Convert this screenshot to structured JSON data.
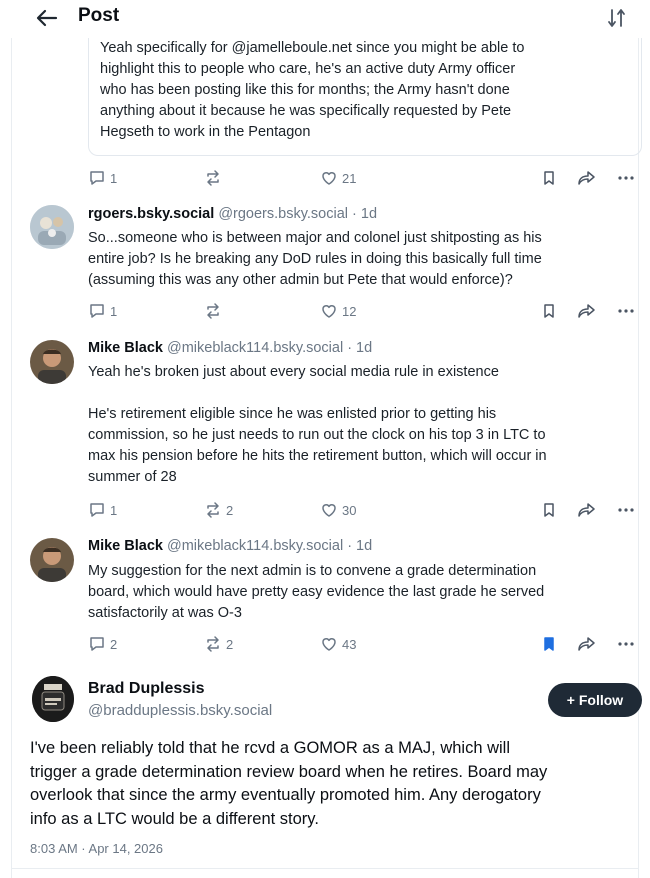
{
  "header": {
    "title": "Post",
    "back_icon": "arrow-left-icon",
    "filter_icon": "sort-filter-icon"
  },
  "quoted": {
    "lines": [
      "Yeah specifically for @jamelleboule.net since you might be able to",
      "highlight this to people who care, he's an active duty Army officer",
      "who has been posting like this for months; the Army hasn't done",
      "anything about it because he was specifically requested by Pete",
      "Hegseth to work in the Pentagon"
    ],
    "actions": {
      "replies": "1",
      "reposts": "",
      "likes": "21"
    }
  },
  "replies": [
    {
      "name": "rgoers.bsky.social",
      "handle": "@rgoers.bsky.social · 1d",
      "lines": [
        "So...someone who is between major and colonel just shitposting as his",
        "entire job? Is he breaking any DoD rules in doing this basically full time",
        "(assuming this was any other admin but Pete that would enforce)?"
      ],
      "actions": {
        "replies": "1",
        "reposts": "",
        "likes": "12"
      }
    },
    {
      "name": "Mike Black",
      "handle": "@mikeblack114.bsky.social · 1d",
      "lines": [
        "Yeah he's broken just about every social media rule in existence",
        "",
        "He's retirement eligible since he was enlisted prior to getting his",
        "commission, so he just needs to run out the clock on his top 3 in LTC to",
        "max his pension before he hits the retirement button, which will occur in",
        "summer of 28"
      ],
      "actions": {
        "replies": "1",
        "reposts": "2",
        "likes": "30"
      }
    },
    {
      "name": "Mike Black",
      "handle": "@mikeblack114.bsky.social · 1d",
      "lines": [
        "My suggestion for the next admin is to convene a grade determination",
        "board, which would have pretty easy evidence the last grade he served",
        "satisfactorily at was O-3"
      ],
      "actions": {
        "replies": "2",
        "reposts": "2",
        "likes": "43"
      }
    }
  ],
  "main_post": {
    "name": "Brad Duplessis",
    "handle": "@bradduplessis.bsky.social",
    "follow_label": "+ Follow",
    "lines": [
      "I've been reliably told that he rcvd a GOMOR as a MAJ, which will",
      "trigger a grade determination review board when he retires. Board may",
      "overlook that since the army eventually promoted him. Any derogatory",
      "info as a LTC would be a different story."
    ],
    "date": "8:03 AM · Apr 14, 2026"
  },
  "colors": {
    "accent_blue": "#1f6fe0",
    "muted": "#6b7785",
    "follow_bg": "#1f2a36"
  }
}
